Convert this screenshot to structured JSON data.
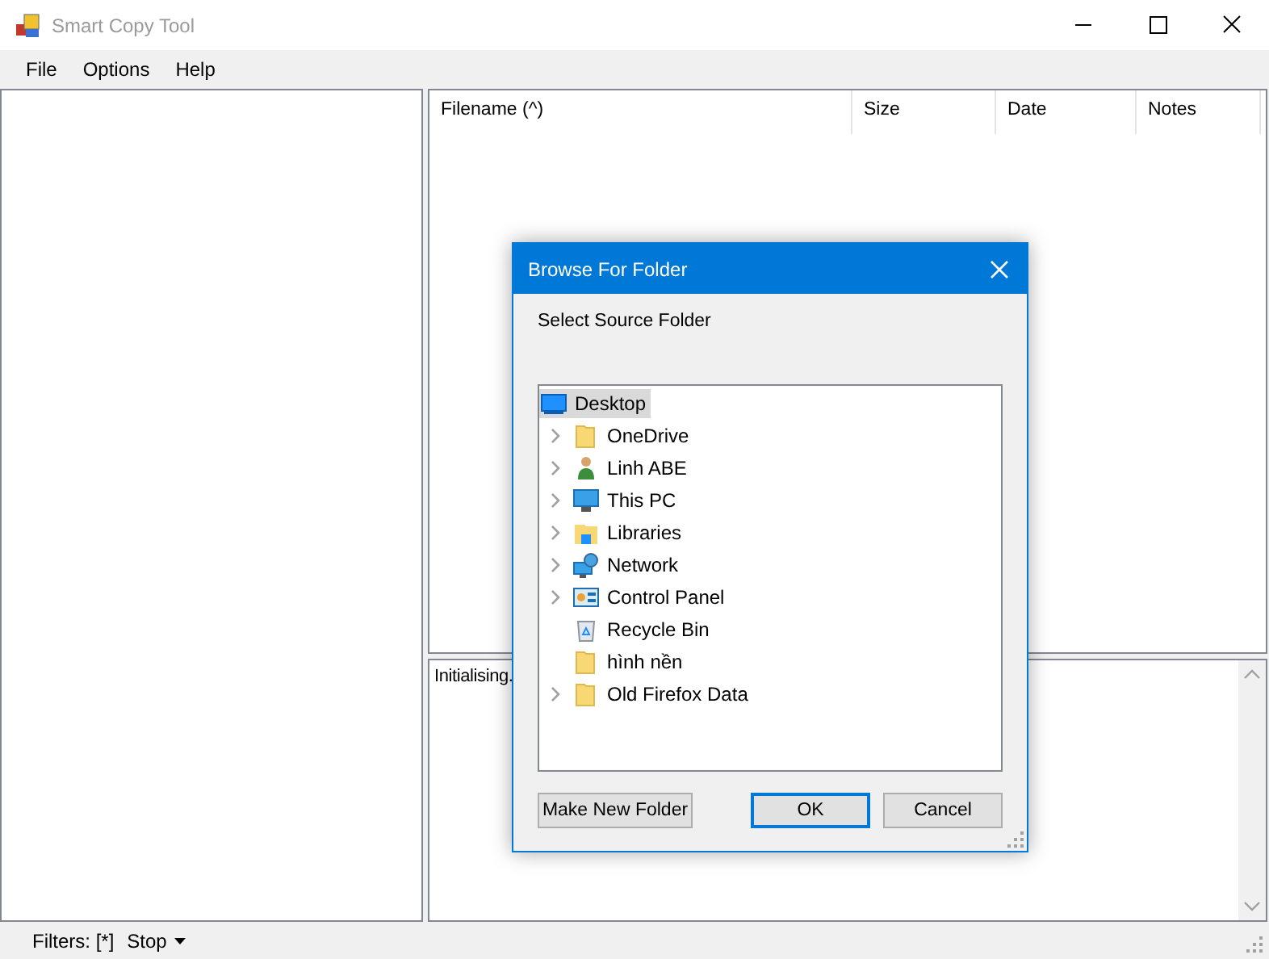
{
  "window": {
    "title": "Smart Copy Tool"
  },
  "menu": [
    "File",
    "Options",
    "Help"
  ],
  "file_list": {
    "columns": [
      "Filename (^)",
      "Size",
      "Date",
      "Notes"
    ]
  },
  "log": {
    "text": "Initialising."
  },
  "status_bar": {
    "filters": "Filters: [*]",
    "action": "Stop"
  },
  "dialog": {
    "title": "Browse For Folder",
    "prompt": "Select Source Folder",
    "tree": [
      {
        "label": "Desktop",
        "kind": "desktop",
        "selected": true,
        "expandable": false,
        "children": [
          {
            "label": "OneDrive",
            "kind": "folder",
            "selected": false,
            "expandable": true
          },
          {
            "label": "Linh ABE",
            "kind": "user",
            "selected": false,
            "expandable": true
          },
          {
            "label": "This PC",
            "kind": "computer",
            "selected": false,
            "expandable": true
          },
          {
            "label": "Libraries",
            "kind": "libraries",
            "selected": false,
            "expandable": true
          },
          {
            "label": "Network",
            "kind": "network",
            "selected": false,
            "expandable": true
          },
          {
            "label": "Control Panel",
            "kind": "control-panel",
            "selected": false,
            "expandable": true
          },
          {
            "label": "Recycle Bin",
            "kind": "recycle-bin",
            "selected": false,
            "expandable": false
          },
          {
            "label": "hình nền",
            "kind": "folder",
            "selected": false,
            "expandable": false
          },
          {
            "label": "Old Firefox Data",
            "kind": "folder",
            "selected": false,
            "expandable": true
          }
        ]
      }
    ],
    "buttons": [
      {
        "label": "Make New Folder",
        "default": false
      },
      {
        "label": "OK",
        "default": true
      },
      {
        "label": "Cancel",
        "default": false
      }
    ]
  }
}
